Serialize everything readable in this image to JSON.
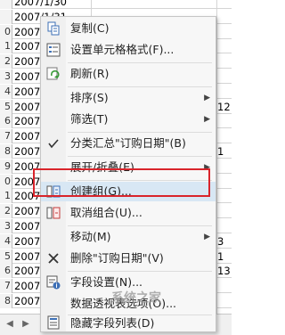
{
  "sheet": {
    "rows": [
      {
        "num": "",
        "date": "2007/1/30",
        "right": ""
      },
      {
        "num": "",
        "date": "2007/1/31",
        "right": ""
      },
      {
        "num": "0",
        "date": "2007",
        "right": ""
      },
      {
        "num": "1",
        "date": "2007",
        "right": ""
      },
      {
        "num": "2",
        "date": "2007",
        "right": ""
      },
      {
        "num": "3",
        "date": "2007",
        "right": ""
      },
      {
        "num": "4",
        "date": "2007",
        "right": ""
      },
      {
        "num": "5",
        "date": "2007",
        "right": "12"
      },
      {
        "num": "6",
        "date": "2007",
        "right": ""
      },
      {
        "num": "7",
        "date": "2007",
        "right": ""
      },
      {
        "num": "8",
        "date": "2007",
        "right": "1"
      },
      {
        "num": "9",
        "date": "2007",
        "right": ""
      },
      {
        "num": "0",
        "date": "2007",
        "right": ""
      },
      {
        "num": "1",
        "date": "2007",
        "right": ""
      },
      {
        "num": "2",
        "date": "2007",
        "right": ""
      },
      {
        "num": "3",
        "date": "2007",
        "right": ""
      },
      {
        "num": "4",
        "date": "2007",
        "right": "3"
      },
      {
        "num": "5",
        "date": "2007",
        "right": "1"
      },
      {
        "num": "6",
        "date": "2007",
        "right": "13"
      },
      {
        "num": "7",
        "date": "2007",
        "right": ""
      },
      {
        "num": "8",
        "date": "2007",
        "right": ""
      }
    ],
    "tab_prev": "◀",
    "tab_next": "▶"
  },
  "menu": {
    "items": [
      {
        "label": "复制(C)",
        "icon": "copy-icon"
      },
      {
        "label": "设置单元格格式(F)...",
        "icon": "format-cells-icon"
      },
      {
        "label": "刷新(R)",
        "icon": "refresh-icon"
      },
      {
        "label": "排序(S)",
        "icon": "",
        "submenu": true
      },
      {
        "label": "筛选(T)",
        "icon": "",
        "submenu": true
      },
      {
        "label": "分类汇总\"订购日期\"(B)",
        "icon": "checkmark-icon"
      },
      {
        "label": "展开/折叠(E)",
        "icon": "",
        "submenu": true
      },
      {
        "label": "创建组(G)...",
        "icon": "group-icon"
      },
      {
        "label": "取消组合(U)...",
        "icon": "ungroup-icon"
      },
      {
        "label": "移动(M)",
        "icon": "",
        "submenu": true
      },
      {
        "label": "删除\"订购日期\"(V)",
        "icon": "delete-x-icon"
      },
      {
        "label": "字段设置(N)...",
        "icon": "field-settings-icon"
      },
      {
        "label": "数据透视表选项(O)...",
        "icon": ""
      },
      {
        "label": "隐藏字段列表(D)",
        "icon": "field-list-icon"
      }
    ],
    "submenu_arrow": "▶"
  },
  "watermark": "系统之家"
}
